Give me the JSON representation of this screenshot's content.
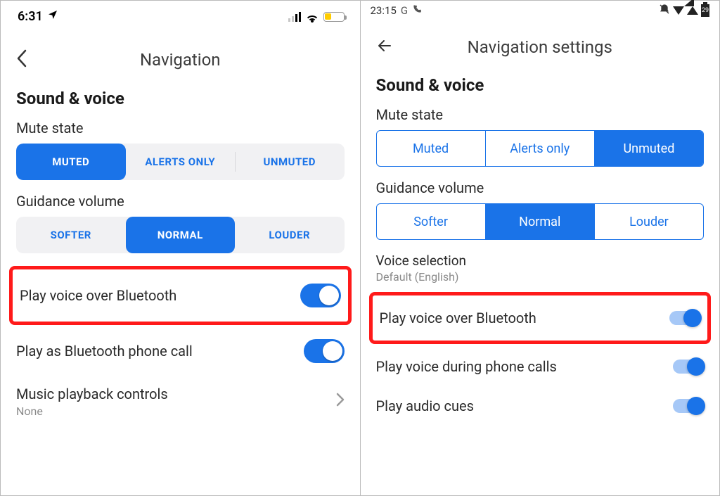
{
  "ios": {
    "status": {
      "time": "6:31",
      "location_icon": "location-arrow-icon"
    },
    "title": "Navigation",
    "section": "Sound & voice",
    "mute": {
      "label": "Mute state",
      "options": [
        "MUTED",
        "ALERTS ONLY",
        "UNMUTED"
      ],
      "selected": "MUTED"
    },
    "guidance": {
      "label": "Guidance volume",
      "options": [
        "SOFTER",
        "NORMAL",
        "LOUDER"
      ],
      "selected": "NORMAL"
    },
    "rows": {
      "pvob": {
        "title": "Play voice over Bluetooth",
        "toggle": true,
        "highlighted": true
      },
      "pabpc": {
        "title": "Play as Bluetooth phone call",
        "toggle": true
      },
      "mpc": {
        "title": "Music playback controls",
        "sub": "None",
        "chevron": true
      }
    }
  },
  "android": {
    "status": {
      "time": "23:15",
      "batt": "29"
    },
    "title": "Navigation settings",
    "section": "Sound & voice",
    "mute": {
      "label": "Mute state",
      "options": [
        "Muted",
        "Alerts only",
        "Unmuted"
      ],
      "selected": "Unmuted"
    },
    "guidance": {
      "label": "Guidance volume",
      "options": [
        "Softer",
        "Normal",
        "Louder"
      ],
      "selected": "Normal"
    },
    "voice": {
      "label": "Voice selection",
      "value": "Default (English)"
    },
    "rows": {
      "pvob": {
        "title": "Play voice over Bluetooth",
        "toggle": true,
        "highlighted": true
      },
      "pvdpc": {
        "title": "Play voice during phone calls",
        "toggle": true
      },
      "pac": {
        "title": "Play audio cues",
        "toggle": true
      }
    }
  }
}
